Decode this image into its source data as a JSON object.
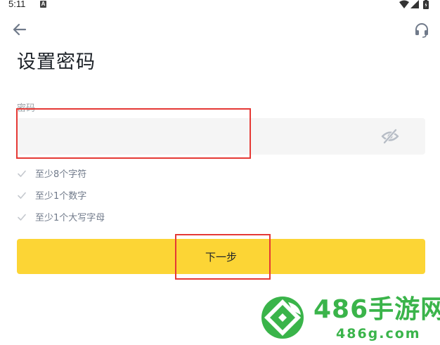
{
  "status_bar": {
    "time": "5:11",
    "notification_icon": "A"
  },
  "header": {
    "back_icon": "arrow-left-icon",
    "support_icon": "headset-icon"
  },
  "page": {
    "title": "设置密码"
  },
  "password_field": {
    "label": "密码",
    "value": "",
    "placeholder": ""
  },
  "rules": [
    {
      "text": "至少8个字符"
    },
    {
      "text": "至少1个数字"
    },
    {
      "text": "至少1个大写字母"
    }
  ],
  "next_button": {
    "label": "下一步"
  },
  "watermark": {
    "name": "486手游网",
    "domain": "486g.com"
  },
  "colors": {
    "accent": "#fcd535",
    "highlight": "#e53935",
    "input_bg": "#f5f5f5",
    "muted_text": "#707a8a",
    "watermark": "#3ab44a"
  }
}
